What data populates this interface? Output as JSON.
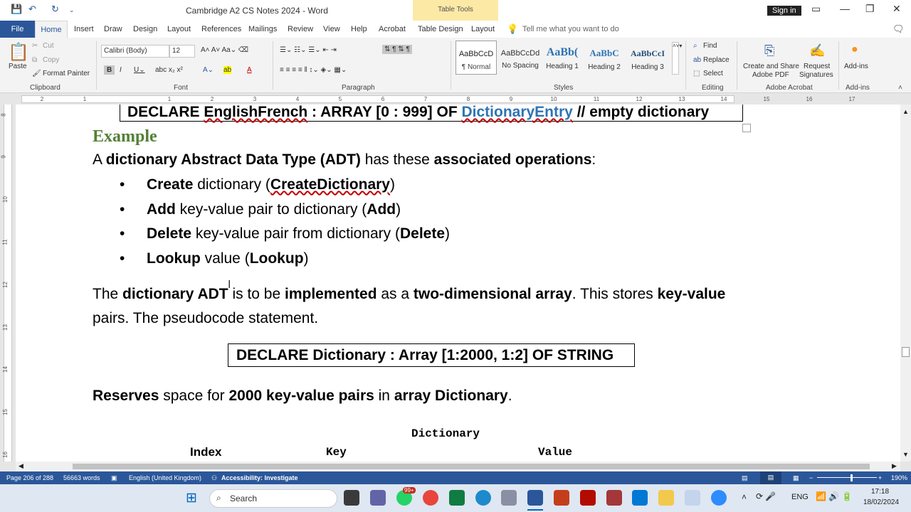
{
  "app": {
    "title": "Cambridge A2 CS Notes 2024  -  Word",
    "table_tools": "Table Tools",
    "signin": "Sign in"
  },
  "tabs": [
    "Insert",
    "Draw",
    "Design",
    "Layout",
    "References",
    "Mailings",
    "Review",
    "View",
    "Help",
    "Acrobat",
    "Table Design",
    "Layout"
  ],
  "tab_file": "File",
  "tab_home": "Home",
  "tellme": "Tell me what you want to do",
  "ribbon": {
    "clipboard": {
      "paste": "Paste",
      "cut": "Cut",
      "copy": "Copy",
      "format_painter": "Format Painter",
      "label": "Clipboard"
    },
    "font": {
      "name": "Calibri (Body)",
      "size": "12",
      "label": "Font"
    },
    "paragraph": {
      "label": "Paragraph"
    },
    "styles": {
      "items": [
        {
          "sample": "AaBbCcD",
          "name": "¶ Normal"
        },
        {
          "sample": "AaBbCcDd",
          "name": "No Spacing"
        },
        {
          "sample": "AaBb(",
          "name": "Heading 1"
        },
        {
          "sample": "AaBbC",
          "name": "Heading 2"
        },
        {
          "sample": "AaBbCcI",
          "name": "Heading 3"
        }
      ],
      "label": "Styles"
    },
    "editing": {
      "find": "Find",
      "replace": "Replace",
      "select": "Select",
      "label": "Editing"
    },
    "acrobat": {
      "create": "Create and Share",
      "create2": "Adobe PDF",
      "request": "Request",
      "request2": "Signatures",
      "label": "Adobe Acrobat"
    },
    "addins": {
      "btn": "Add-ins",
      "label": "Add-ins"
    }
  },
  "ruler": {
    "numbers": [
      "2",
      "1",
      "1",
      "2",
      "3",
      "4",
      "5",
      "6",
      "7",
      "8",
      "9",
      "10",
      "11",
      "12",
      "13",
      "14",
      "15",
      "16",
      "17"
    ],
    "vnumbers": [
      "8",
      "9",
      "10",
      "11",
      "12",
      "13",
      "14",
      "15",
      "16"
    ]
  },
  "document": {
    "declare1_a": "DECLARE ",
    "declare1_b": "EnglishFrench",
    ": ": "",
    "declare1_c": " : ARRAY [0 : 999] OF ",
    "declare1_d": "DictionaryEntry",
    "declare1_e": " // empty dictionary",
    "example": "Example",
    "intro_a": "A ",
    "intro_b": "dictionary Abstract Data Type (ADT)",
    "intro_c": " has these ",
    "intro_d": "associated operations",
    "intro_e": ":",
    "bullets": [
      {
        "b1": "Create",
        "t1": " dictionary (",
        "b2": "CreateDictionary",
        "t2": ")"
      },
      {
        "b1": "Add",
        "t1": " key-value pair to dictionary (",
        "b2": "Add",
        "t2": ")"
      },
      {
        "b1": "Delete",
        "t1": " key-value pair from dictionary (",
        "b2": "Delete",
        "t2": ")"
      },
      {
        "b1": "Lookup",
        "t1": " value (",
        "b2": "Lookup",
        "t2": ")"
      }
    ],
    "p2_a": "The ",
    "p2_b": "dictionary ADT",
    "p2_c": " is to be ",
    "p2_d": "implemented",
    "p2_e": " as a ",
    "p2_f": "two-dimensional array",
    "p2_g": ". This stores ",
    "p2_h": "key-value",
    "p2_line2": "pairs. The pseudocode statement.",
    "declare2": "DECLARE Dictionary : Array [1:2000, 1:2] OF STRING",
    "p3_a": "Reserves",
    "p3_b": " space for ",
    "p3_c": "2000 key-value pairs",
    "p3_d": " in ",
    "p3_e": "array Dictionary",
    "p3_f": ".",
    "table_title": "Dictionary",
    "col_index": "Index",
    "col_key": "Key",
    "col_value": "Value"
  },
  "status": {
    "page": "Page 206 of 288",
    "words": "56663 words",
    "lang": "English (United Kingdom)",
    "access": "Accessibility: Investigate",
    "zoom": "190%"
  },
  "taskbar": {
    "search": "Search",
    "badge": "99+",
    "lang": "ENG",
    "time": "17:18",
    "date": "18/02/2024"
  },
  "colors": {
    "word_blue": "#2b579a",
    "example_green": "#538135",
    "link_blue": "#2e74b5"
  }
}
